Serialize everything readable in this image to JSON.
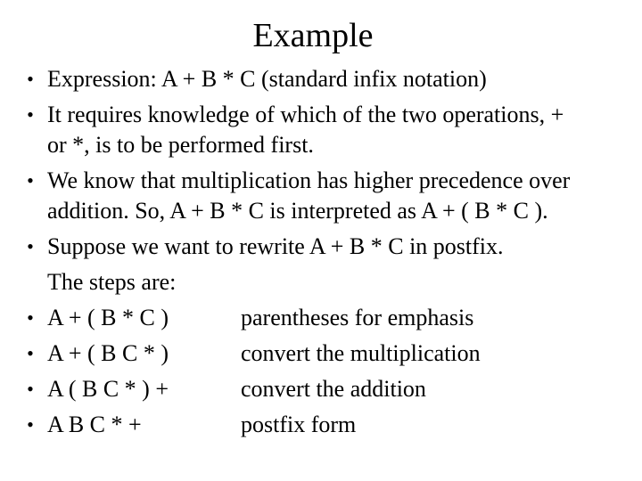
{
  "slide": {
    "title": "Example",
    "bullet_glyph": "•",
    "bullets": [
      {
        "lines": [
          "Expression: A + B * C  (standard infix notation)"
        ]
      },
      {
        "lines": [
          "It requires knowledge of which of the two operations, +",
          "or *, is to be performed first."
        ]
      },
      {
        "lines": [
          "We know that multiplication has higher precedence over",
          "addition. So, A + B * C is interpreted as A + ( B * C )."
        ]
      },
      {
        "lines": [
          "Suppose we want to rewrite A + B * C in postfix.",
          "The steps are:"
        ]
      }
    ],
    "steps": [
      {
        "expression": "A + ( B * C )",
        "description": "parentheses for emphasis"
      },
      {
        "expression": "A + ( B C * )",
        "description": "convert the multiplication"
      },
      {
        "expression": "A ( B C * ) +",
        "description": "convert the addition"
      },
      {
        "expression": "A B C * +",
        "description": "postfix form"
      }
    ]
  }
}
